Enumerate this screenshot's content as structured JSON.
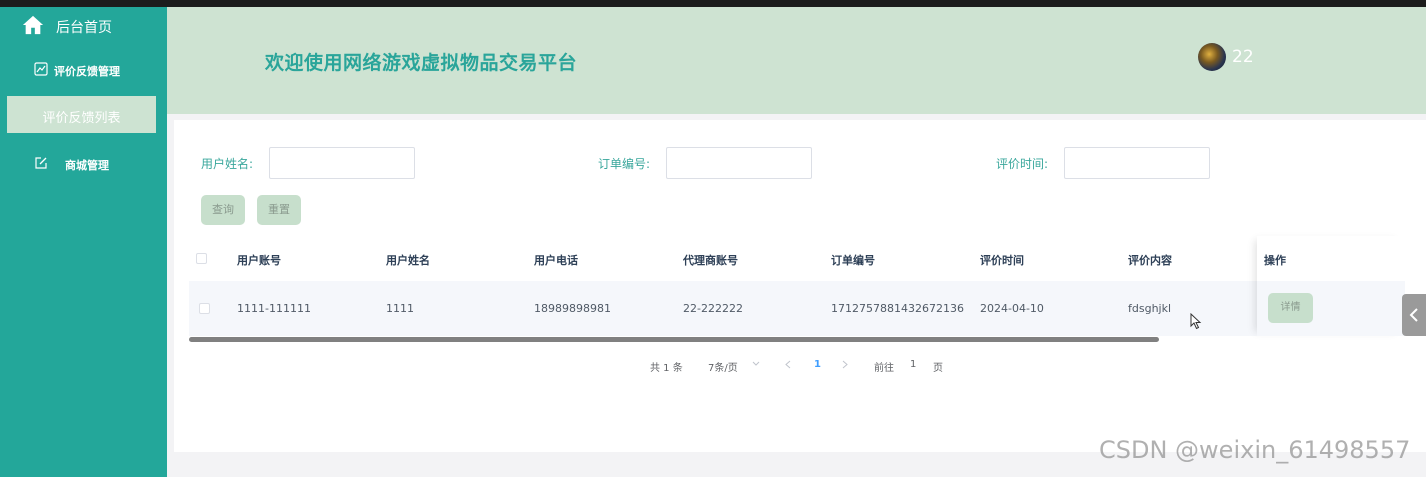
{
  "sidebar": {
    "home_label": "后台首页",
    "menus": [
      {
        "label": "评价反馈管理",
        "icon": "chart-icon"
      },
      {
        "label": "商城管理",
        "icon": "edit-icon"
      }
    ],
    "active_sub_label": "评价反馈列表"
  },
  "header": {
    "title": "欢迎使用网络游戏虚拟物品交易平台",
    "username": "22"
  },
  "filters": {
    "user_name_label": "用户姓名:",
    "order_no_label": "订单编号:",
    "review_time_label": "评价时间:",
    "search_button": "查询",
    "reset_button": "重置"
  },
  "table": {
    "columns": [
      "用户账号",
      "用户姓名",
      "用户电话",
      "代理商账号",
      "订单编号",
      "评价时间",
      "评价内容",
      "操作"
    ],
    "rows": [
      [
        "1111-111111",
        "1111",
        "18989898981",
        "22-222222",
        "1712757881432672136",
        "2024-04-10",
        "fdsghjkl"
      ]
    ],
    "detail_button": "详情"
  },
  "pagination": {
    "total": "共 1 条",
    "page_size": "7条/页",
    "current_page": "1",
    "goto_label": "前往",
    "goto_value": "1",
    "page_suffix": "页"
  },
  "watermark": "CSDN @weixin_61498557",
  "colors": {
    "sidebar": "#23a79a",
    "header": "#cee3d2",
    "accent_text": "#2aa59a",
    "button": "#c7dfcc",
    "pagination_active": "#409eff"
  }
}
